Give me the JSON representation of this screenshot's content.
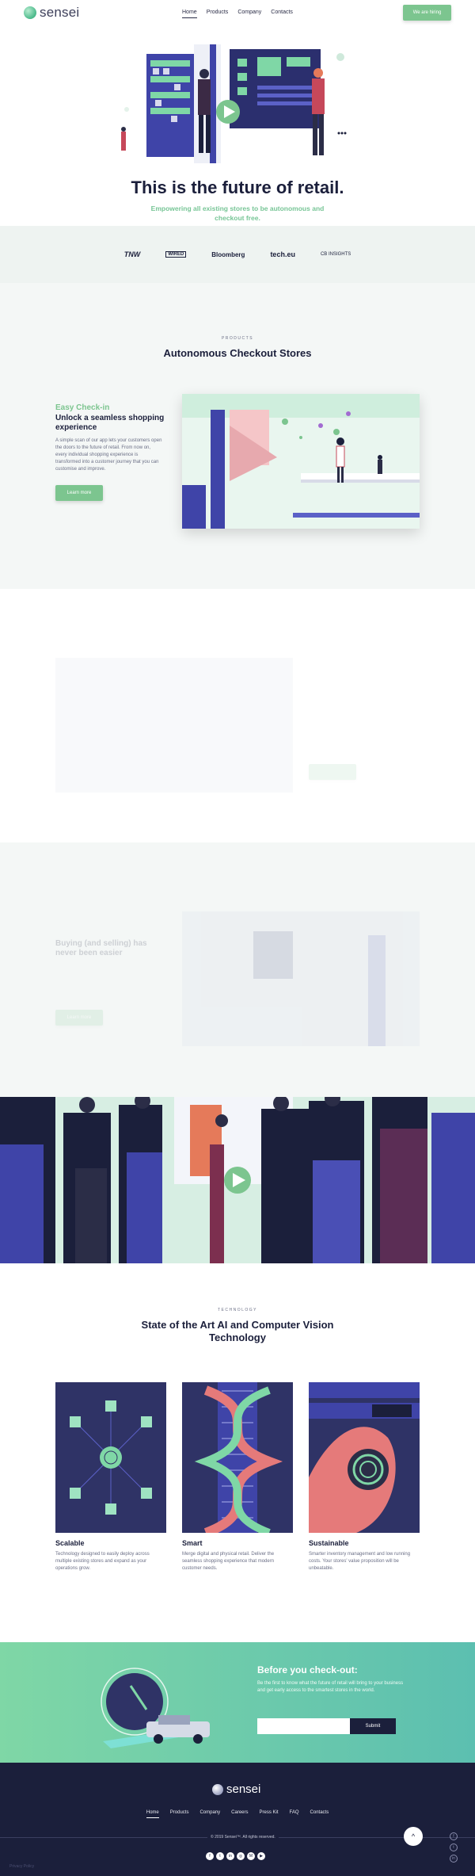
{
  "brand": {
    "name": "sensei"
  },
  "nav": {
    "links": [
      "Home",
      "Products",
      "Company",
      "Contacts"
    ],
    "cta": "We are hiring"
  },
  "hero": {
    "title": "This is the future of retail.",
    "subtitle": "Empowering all existing stores to be autonomous and checkout free."
  },
  "press": [
    "TNW",
    "WIRED",
    "Bloomberg",
    "tech.eu",
    "CB INSIGHTS"
  ],
  "products": {
    "eyebrow": "PRODUCTS",
    "title": "Autonomous Checkout Stores",
    "feature1": {
      "kicker": "Easy Check-in",
      "title": "Unlock a seamless shopping experience",
      "desc": "A simple scan of our app lets your customers open the doors to the future of retail. From now on, every individual shopping experience is transformed into a customer journey that you can customise and improve.",
      "button": "Learn more"
    },
    "feature3": {
      "title": "Buying (and selling) has never been easier",
      "button": "Learn more"
    }
  },
  "technology": {
    "eyebrow": "TECHNOLOGY",
    "title": "State of the Art AI and Computer Vision Technology",
    "cards": [
      {
        "title": "Scalable",
        "desc": "Technology designed to easily deploy across multiple existing stores and expand as your operations grow."
      },
      {
        "title": "Smart",
        "desc": "Merge digital and physical retail. Deliver the seamless shopping experience that modern customer needs."
      },
      {
        "title": "Sustainable",
        "desc": "Smarter inventory management and low running costs. Your stores' value proposition will be unbeatable."
      }
    ]
  },
  "cta": {
    "title": "Before you check-out:",
    "desc": "Be the first to know what the future of retail will bring to your business and get early access to the smartest stores in the world.",
    "placeholder": "",
    "button": "Submit"
  },
  "footer": {
    "links": [
      "Home",
      "Products",
      "Company",
      "Careers",
      "Press Kit",
      "FAQ",
      "Contacts"
    ],
    "copyright": "© 2019 Sensei™. All rights reserved.",
    "privacy": "Privacy Policy"
  },
  "colors": {
    "brand_green": "#7cc58f",
    "navy": "#1b1f3b",
    "indigo": "#3f44a8"
  }
}
